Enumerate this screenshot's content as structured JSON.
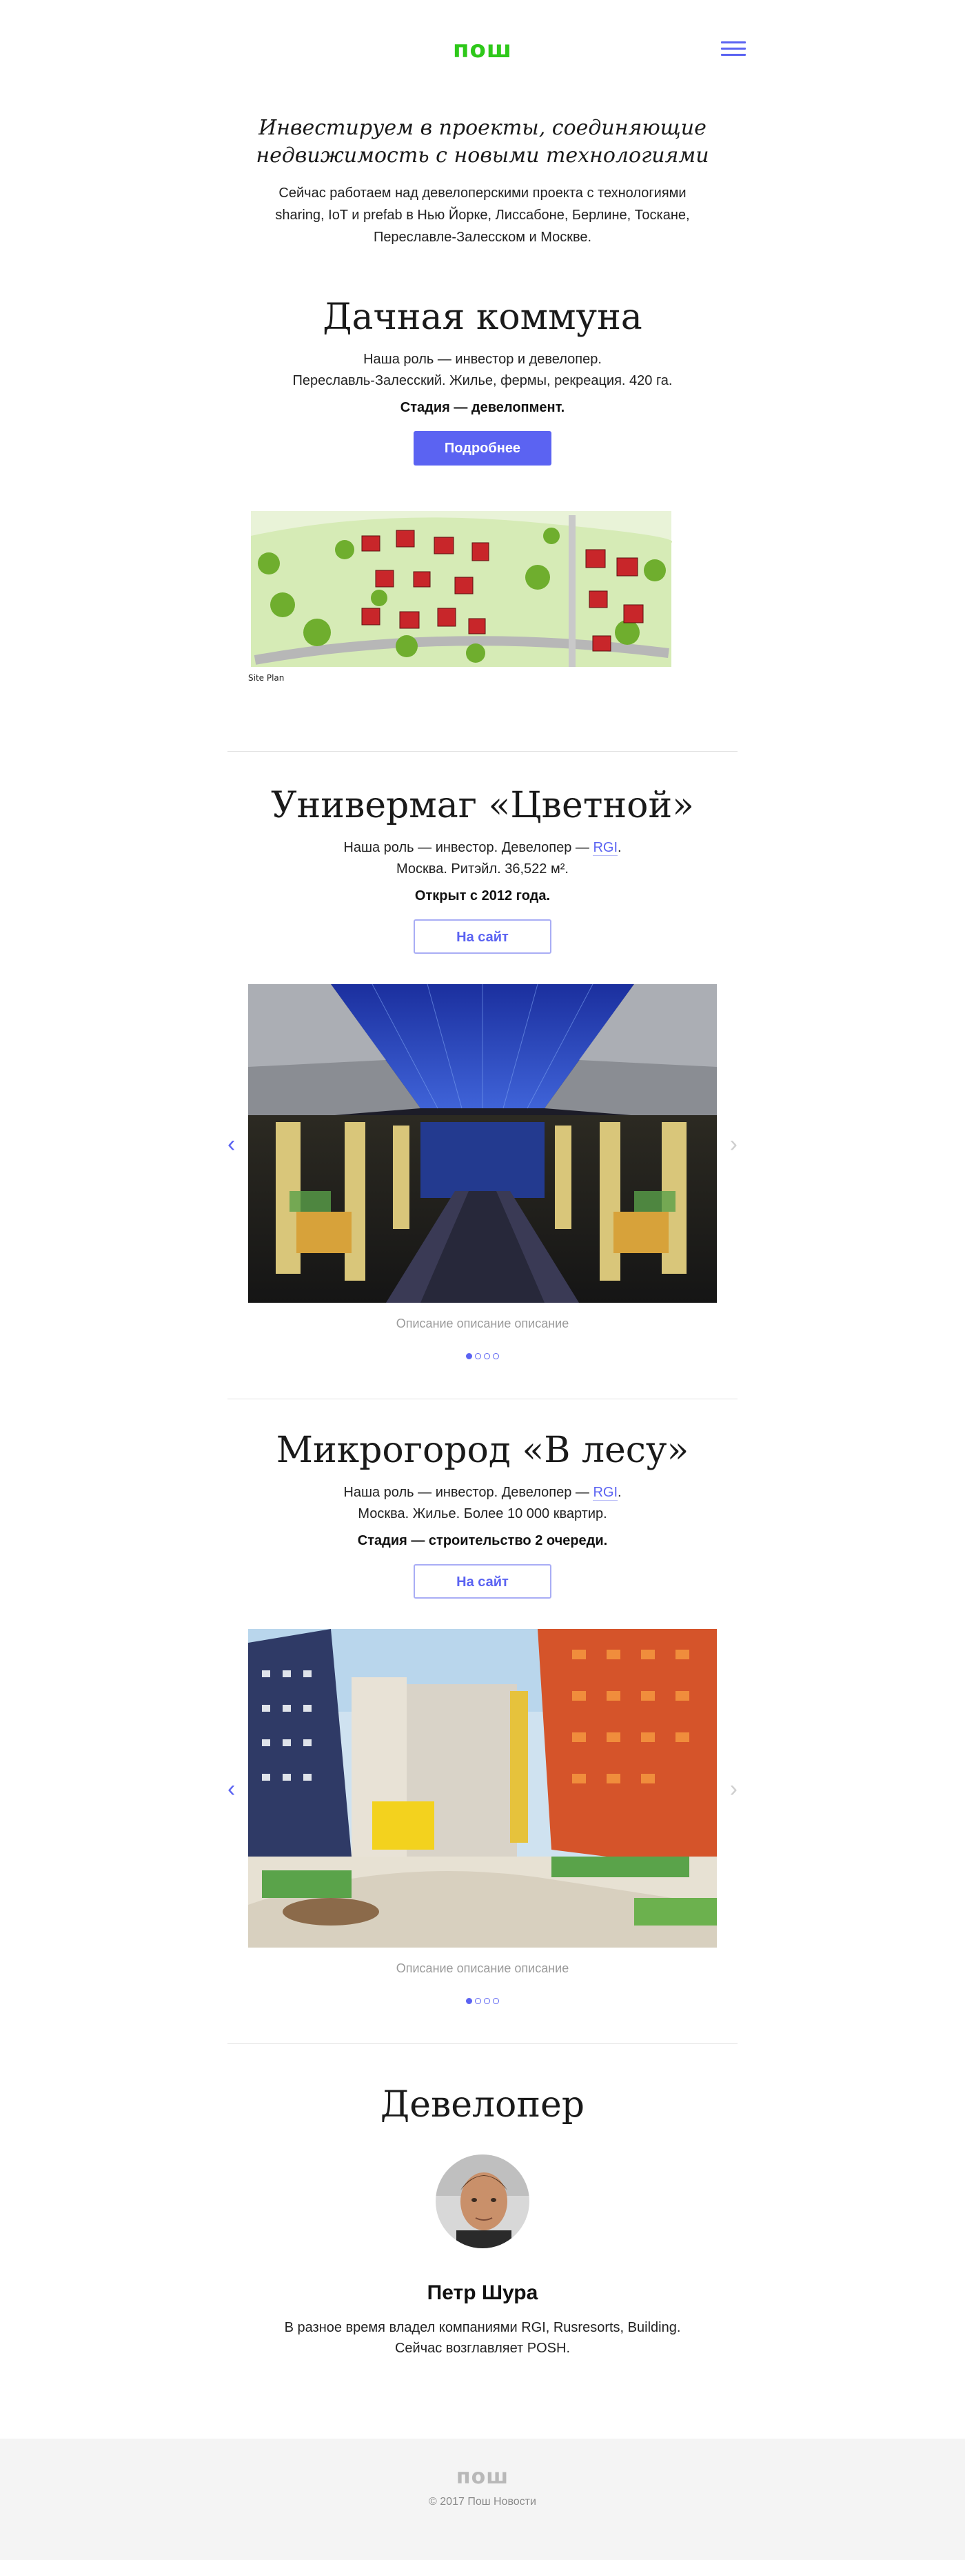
{
  "header": {
    "logo": "пош",
    "menu_icon": "hamburger-icon"
  },
  "intro": {
    "title_line1": "Инвестируем в проекты, соединяющие",
    "title_line2": "недвижимость с новыми технологиями",
    "text_line1": "Сейчас работаем над девелоперскими проекта с технологиями",
    "text_line2": "sharing, IoT и prefab в Нью Йорке, Лиссабоне, Берлине, Тоскане,",
    "text_line3": "Переславле-Залесском и Москве."
  },
  "projects": [
    {
      "title": "Дачная коммуна",
      "desc_line1": "Наша роль — инвестор и девелопер.",
      "desc_line2": "Переславль-Залесский. Жилье, фермы, рекреация. 420 га.",
      "stage": "Стадия — девелопмент.",
      "button": "Подробнее",
      "image_label": "Site Plan"
    },
    {
      "title": "Универмаг «Цветной»",
      "desc_pre": "Наша роль — инвестор. Девелопер — ",
      "desc_link": "RGI",
      "desc_post": ".",
      "desc_line2": "Москва. Ритэйл. 36,522 м².",
      "stage": "Открыт с 2012 года.",
      "button": "На сайт",
      "caption": "Описание описание описание"
    },
    {
      "title": "Микрогород «В лесу»",
      "desc_pre": "Наша роль — инвестор. Девелопер — ",
      "desc_link": "RGI",
      "desc_post": ".",
      "desc_line2": "Москва. Жилье. Более 10 000 квартир.",
      "stage": "Стадия — строительство 2 очереди.",
      "button": "На сайт",
      "caption": "Описание описание описание"
    }
  ],
  "slider": {
    "prev_icon": "chevron-left-icon",
    "next_icon": "chevron-right-icon",
    "prev": "‹",
    "next": "›"
  },
  "developer": {
    "section_title": "Девелопер",
    "name": "Петр Шура",
    "text_line1": "В разное время владел компаниями RGI, Rusresorts, Building.",
    "text_line2": "Сейчас возглавляет POSH."
  },
  "footer": {
    "logo": "пош",
    "copyright": "© 2017 Пош Новости"
  },
  "colors": {
    "brand_green": "#2ec81a",
    "accent": "#5b63f2",
    "footer_bg": "#f4f4f4"
  }
}
